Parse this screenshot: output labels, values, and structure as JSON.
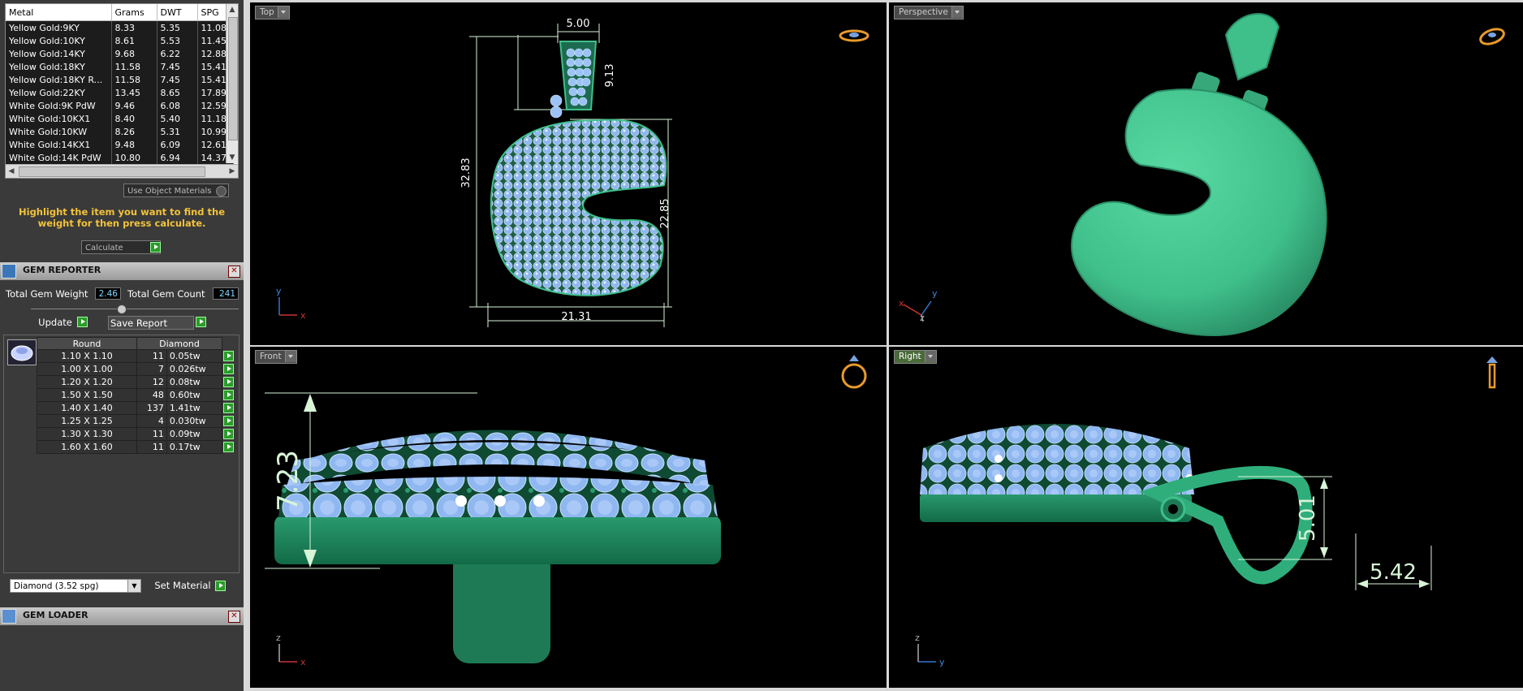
{
  "metal_table": {
    "headers": [
      "Metal",
      "Grams",
      "DWT",
      "SPG"
    ],
    "rows": [
      [
        "Yellow Gold:9KY",
        "8.33",
        "5.35",
        "11.08"
      ],
      [
        "Yellow Gold:10KY",
        "8.61",
        "5.53",
        "11.45"
      ],
      [
        "Yellow Gold:14KY",
        "9.68",
        "6.22",
        "12.88"
      ],
      [
        "Yellow Gold:18KY",
        "11.58",
        "7.45",
        "15.41"
      ],
      [
        "Yellow Gold:18KY R...",
        "11.58",
        "7.45",
        "15.41"
      ],
      [
        "Yellow Gold:22KY",
        "13.45",
        "8.65",
        "17.89"
      ],
      [
        "White Gold:9K PdW",
        "9.46",
        "6.08",
        "12.59"
      ],
      [
        "White Gold:10KX1",
        "8.40",
        "5.40",
        "11.18"
      ],
      [
        "White Gold:10KW",
        "8.26",
        "5.31",
        "10.99"
      ],
      [
        "White Gold:14KX1",
        "9.48",
        "6.09",
        "12.61"
      ],
      [
        "White Gold:14K PdW",
        "10.80",
        "6.94",
        "14.37"
      ]
    ]
  },
  "use_object_materials": "Use Object Materials",
  "hint": "Highlight the item you want to find the weight for then press calculate.",
  "calculate_label": "Calculate",
  "gem_reporter": {
    "title": "GEM REPORTER",
    "total_weight_label": "Total Gem Weight",
    "total_weight_value": "2.46",
    "total_count_label": "Total Gem Count",
    "total_count_value": "241",
    "update_label": "Update",
    "save_report_label": "Save Report",
    "table_headers": [
      "Round",
      "Diamond"
    ],
    "rows": [
      [
        "1.10 X 1.10",
        "11",
        "0.05tw"
      ],
      [
        "1.00 X 1.00",
        "7",
        "0.026tw"
      ],
      [
        "1.20 X 1.20",
        "12",
        "0.08tw"
      ],
      [
        "1.50 X 1.50",
        "48",
        "0.60tw"
      ],
      [
        "1.40 X 1.40",
        "137",
        "1.41tw"
      ],
      [
        "1.25 X 1.25",
        "4",
        "0.030tw"
      ],
      [
        "1.30 X 1.30",
        "11",
        "0.09tw"
      ],
      [
        "1.60 X 1.60",
        "11",
        "0.17tw"
      ]
    ],
    "material_select": "Diamond    (3.52 spg)",
    "set_material_label": "Set Material"
  },
  "gem_loader": {
    "title": "GEM LOADER"
  },
  "viewports": {
    "top": {
      "label": "Top",
      "dims": {
        "w_top": "5.00",
        "h_bail": "9.13",
        "h_total": "32.83",
        "h_body": "22.85",
        "w_body": "21.31"
      }
    },
    "perspective": {
      "label": "Perspective"
    },
    "front": {
      "label": "Front",
      "dims": {
        "height": "7.23"
      }
    },
    "right": {
      "label": "Right",
      "dims": {
        "bail_h": "5.01",
        "bail_w": "5.42"
      }
    }
  },
  "axes": {
    "x": "x",
    "y": "y",
    "z": "z"
  },
  "colors": {
    "metal_green": "#3fbf8a",
    "gem_blue": "#8fb7f0",
    "dim_line": "#d8f5d8",
    "hint_yellow": "#f2c23a"
  }
}
